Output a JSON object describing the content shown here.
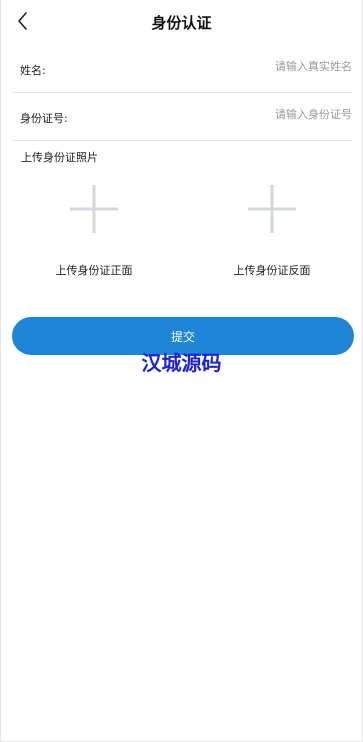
{
  "header": {
    "title": "身份认证",
    "back_icon": "chevron-left-icon"
  },
  "form": {
    "name": {
      "label": "姓名:",
      "value": "",
      "placeholder": "请输入真实姓名"
    },
    "id_number": {
      "label": "身份证号:",
      "value": "",
      "placeholder": "请输入身份证号"
    }
  },
  "upload": {
    "title": "上传身份证照片",
    "front_label": "上传身份证正面",
    "back_label": "上传身份证反面",
    "icon": "plus-icon",
    "icon_color": "#d3d7de"
  },
  "submit": {
    "label": "提交",
    "color": "#1d85d8"
  },
  "watermark": {
    "text": "汉城源码",
    "color": "#1a22d6"
  }
}
